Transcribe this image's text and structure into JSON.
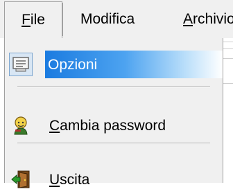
{
  "menubar": {
    "items": [
      {
        "label": "File"
      },
      {
        "label": "Modifica"
      },
      {
        "label": "Archivio"
      }
    ]
  },
  "file_menu": {
    "items": [
      {
        "label": "Opzioni",
        "icon": "options-window-icon",
        "highlighted": true
      },
      {
        "label": "Cambia password",
        "icon": "user-key-icon"
      },
      {
        "label": "Uscita",
        "icon": "exit-door-icon"
      }
    ]
  },
  "colors": {
    "highlight": "#1b7be0",
    "menu_bg": "#f0f0f0"
  }
}
